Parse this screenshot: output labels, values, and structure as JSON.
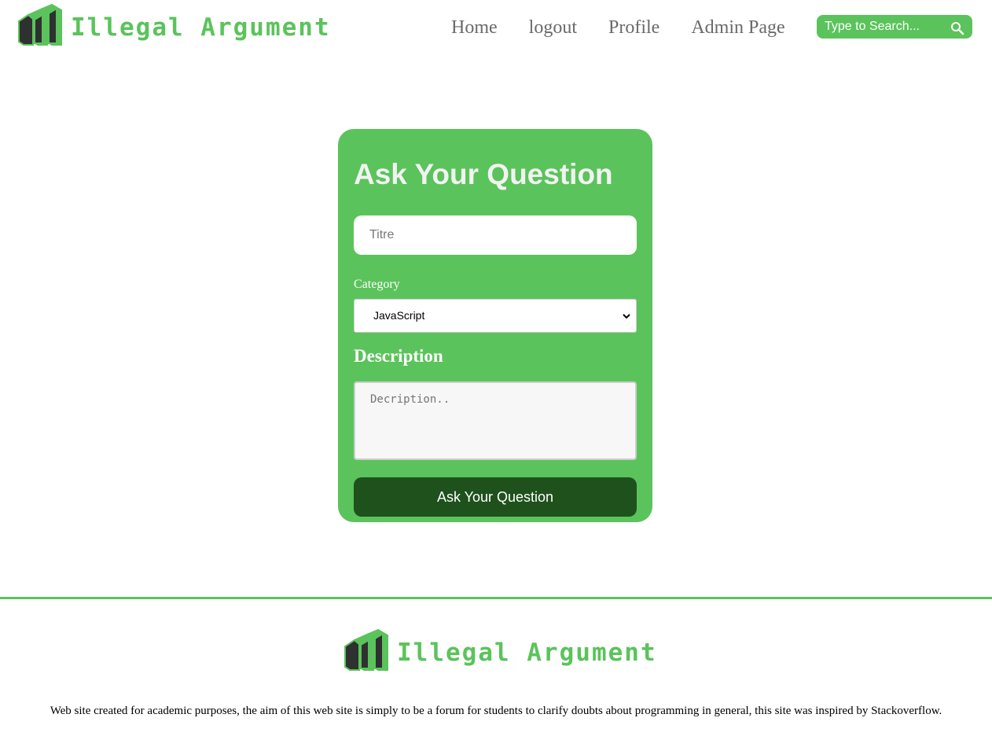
{
  "header": {
    "brand": "Illegal Argument",
    "nav": [
      "Home",
      "logout",
      "Profile",
      "Admin Page"
    ],
    "search_placeholder": "Type to Search..."
  },
  "form": {
    "heading": "Ask Your Question",
    "title_placeholder": "Titre",
    "category_label": "Category",
    "category_selected": "JavaScript",
    "description_label": "Description",
    "description_placeholder": "Decription..",
    "submit_label": "Ask Your Question"
  },
  "footer": {
    "brand": "Illegal Argument",
    "text": "Web site created for academic purposes, the aim of this web site is simply to be a forum for students to clarify doubts about programming in general, this site was inspired by Stackoverflow."
  },
  "colors": {
    "accent": "#5bc35b",
    "button_dark": "#1e511c",
    "logo_dark": "#2f3030"
  },
  "icons": [
    "logo-icon",
    "search-icon",
    "chevron-down-icon"
  ]
}
